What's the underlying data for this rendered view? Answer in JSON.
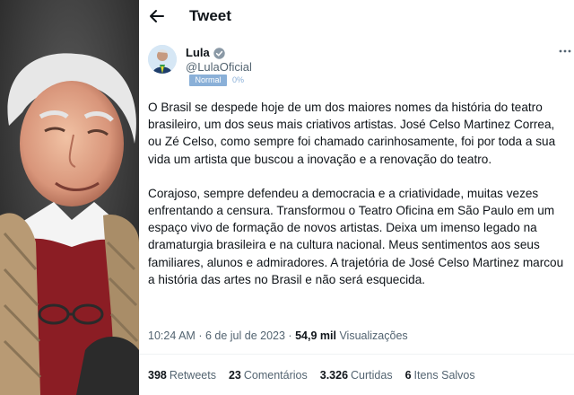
{
  "header": {
    "title": "Tweet"
  },
  "author": {
    "name": "Lula",
    "handle": "@LulaOficial",
    "badge": "Normal",
    "percent": "0%"
  },
  "tweet": {
    "paragraph1": "O Brasil se despede hoje de um dos maiores nomes da história do teatro brasileiro, um dos seus mais criativos artistas. José Celso Martinez Correa, ou Zé Celso, como sempre foi chamado carinhosamente, foi por toda a sua vida um artista que buscou a inovação e a renovação do teatro.",
    "paragraph2": "Corajoso, sempre defendeu a democracia e a criatividade, muitas vezes enfrentando a censura. Transformou o Teatro Oficina em São Paulo em um espaço vivo de formação de novos artistas. Deixa um imenso legado na dramaturgia brasileira e na cultura nacional. Meus sentimentos aos seus familiares, alunos e admiradores. A trajetória de José Celso Martinez marcou a história das artes no Brasil e não será esquecida.",
    "time": "10:24 AM",
    "separator": "·",
    "date": "6 de jul de 2023",
    "views": "54,9 mil",
    "views_label": "Visualizações"
  },
  "stats": {
    "retweets_count": "398",
    "retweets_label": "Retweets",
    "comments_count": "23",
    "comments_label": "Comentários",
    "likes_count": "3.326",
    "likes_label": "Curtidas",
    "saved_count": "6",
    "saved_label": "Itens Salvos"
  },
  "icons": {
    "back": "arrow-left-icon",
    "verified": "verified-badge-icon",
    "more": "more-horizontal-icon"
  },
  "colors": {
    "accent": "#1d9bf0",
    "text": "#0f1419",
    "secondary": "#536471",
    "badge": "#8ab0d8"
  }
}
